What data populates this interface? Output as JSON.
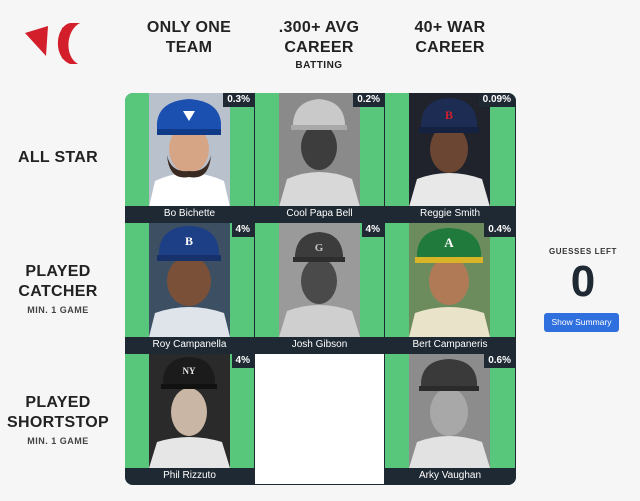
{
  "columns": [
    {
      "title": "ONLY ONE TEAM",
      "subtitle": ""
    },
    {
      "title": ".300+ AVG CAREER",
      "subtitle": "BATTING"
    },
    {
      "title": "40+ WAR CAREER",
      "subtitle": ""
    }
  ],
  "rows": [
    {
      "title": "ALL STAR",
      "subtitle": ""
    },
    {
      "title": "PLAYED CATCHER",
      "subtitle": "MIN. 1 GAME"
    },
    {
      "title": "PLAYED SHORTSTOP",
      "subtitle": "MIN. 1 GAME"
    }
  ],
  "cells": [
    {
      "player": "Bo Bichette",
      "percent": "0.3%"
    },
    {
      "player": "Cool Papa Bell",
      "percent": "0.2%"
    },
    {
      "player": "Reggie Smith",
      "percent": "0.09%"
    },
    {
      "player": "Roy Campanella",
      "percent": "4%"
    },
    {
      "player": "Josh Gibson",
      "percent": "4%"
    },
    {
      "player": "Bert Campaneris",
      "percent": "0.4%"
    },
    {
      "player": "Phil Rizzuto",
      "percent": "4%"
    },
    {
      "player": "",
      "percent": ""
    },
    {
      "player": "Arky Vaughan",
      "percent": "0.6%"
    }
  ],
  "guesses": {
    "label": "GUESSES LEFT",
    "count": "0"
  },
  "summary_button": "Show Summary",
  "colors": {
    "cell_green": "#58c77c",
    "dark": "#1f2933",
    "button_blue": "#2f6fde",
    "logo_red": "#d21f2b"
  }
}
